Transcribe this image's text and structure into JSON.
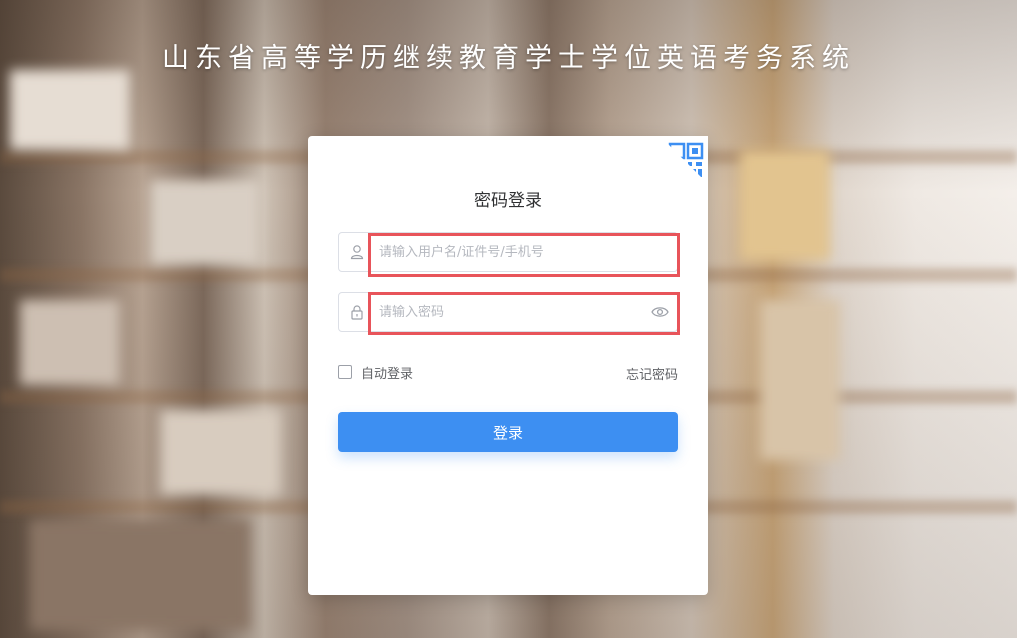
{
  "page": {
    "title": "山东省高等学历继续教育学士学位英语考务系统"
  },
  "login": {
    "heading": "密码登录",
    "username": {
      "placeholder": "请输入用户名/证件号/手机号",
      "value": ""
    },
    "password": {
      "placeholder": "请输入密码",
      "value": ""
    },
    "remember_label": "自动登录",
    "remember_checked": false,
    "forgot_label": "忘记密码",
    "submit_label": "登录"
  },
  "icons": {
    "qr_toggle": "qr-code-icon",
    "username_prefix": "user-icon",
    "password_prefix": "lock-icon",
    "password_toggle": "eye-icon"
  },
  "colors": {
    "primary": "#3d8ff2",
    "highlight_border": "#e8545a",
    "card_background": "#ffffff",
    "title_text": "#ffffff"
  }
}
